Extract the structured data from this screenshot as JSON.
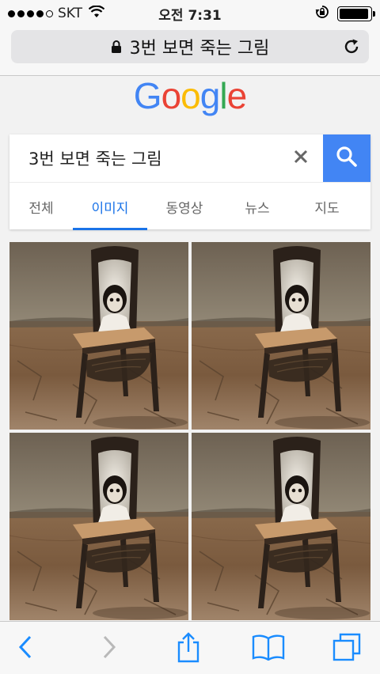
{
  "status_bar": {
    "carrier": "SKT",
    "time": "오전 7:31",
    "battery_level": 0.95
  },
  "address_bar": {
    "url_text": "3번 보면 죽는 그림"
  },
  "logo": {
    "text": "Google",
    "colors": [
      "#4285F4",
      "#EA4335",
      "#FBBC05",
      "#4285F4",
      "#34A853",
      "#EA4335"
    ]
  },
  "search": {
    "query": "3번 보면 죽는 그림"
  },
  "tabs": [
    {
      "label": "전체",
      "active": false
    },
    {
      "label": "이미지",
      "active": true
    },
    {
      "label": "동영상",
      "active": false
    },
    {
      "label": "뉴스",
      "active": false
    },
    {
      "label": "지도",
      "active": false
    }
  ],
  "results": {
    "thumbnail_count": 4
  },
  "colors": {
    "accent": "#1a73e8",
    "search_button": "#4285f4",
    "toolbar_icon": "#1a8cff",
    "toolbar_icon_disabled": "#b9b9b9"
  },
  "icons": [
    "lock-icon",
    "reload-icon",
    "wifi-icon",
    "orientation-lock-icon",
    "clear-icon",
    "search-icon",
    "back-icon",
    "forward-icon",
    "share-icon",
    "bookmarks-icon",
    "tabs-icon"
  ]
}
